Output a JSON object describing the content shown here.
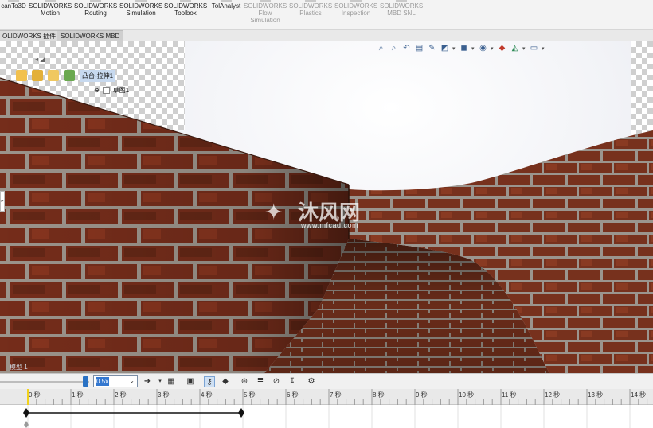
{
  "ribbon": {
    "buttons": [
      {
        "id": "scanto3d",
        "line1": "canTo3D",
        "line2": "",
        "disabled": false
      },
      {
        "id": "motion",
        "line1": "SOLIDWORKS",
        "line2": "Motion",
        "disabled": false
      },
      {
        "id": "routing",
        "line1": "SOLIDWORKS",
        "line2": "Routing",
        "disabled": false
      },
      {
        "id": "simulation",
        "line1": "SOLIDWORKS",
        "line2": "Simulation",
        "disabled": false
      },
      {
        "id": "toolbox",
        "line1": "SOLIDWORKS",
        "line2": "Toolbox",
        "disabled": false
      },
      {
        "id": "tolanalyst",
        "line1": "TolAnalyst",
        "line2": "",
        "disabled": false
      },
      {
        "id": "flow",
        "line1": "SOLIDWORKS",
        "line2": "Flow",
        "line3": "Simulation",
        "disabled": true
      },
      {
        "id": "plastics",
        "line1": "SOLIDWORKS",
        "line2": "Plastics",
        "disabled": true
      },
      {
        "id": "inspection",
        "line1": "SOLIDWORKS",
        "line2": "Inspection",
        "disabled": true
      },
      {
        "id": "mbdsnl",
        "line1": "SOLIDWORKS",
        "line2": "MBD SNL",
        "disabled": true
      }
    ]
  },
  "tabs": [
    {
      "label": "OLIDWORKS 插件",
      "active": false
    },
    {
      "label": "SOLIDWORKS MBD",
      "active": true
    }
  ],
  "tree": {
    "part_name": "凸台-拉伸1",
    "child_name": "草图1"
  },
  "watermark": {
    "brand": "沐风网",
    "url": "www.mfcad.com"
  },
  "viewport": {
    "status_tag": "模型 1"
  },
  "motion": {
    "playback_speed": "0.5x"
  },
  "timeline": {
    "ticks": [
      "0 秒",
      "1 秒",
      "2 秒",
      "3 秒",
      "4 秒",
      "5 秒",
      "6 秒",
      "7 秒",
      "8 秒",
      "9 秒",
      "10 秒",
      "11 秒",
      "12 秒",
      "13 秒",
      "14 秒"
    ],
    "key_start_sec": 0,
    "key_end_sec": 5
  },
  "colors": {
    "accent": "#2a72c4",
    "brick": "#8a3a22",
    "mortar": "#b9b2aa",
    "selection": "#c7d9ef"
  }
}
